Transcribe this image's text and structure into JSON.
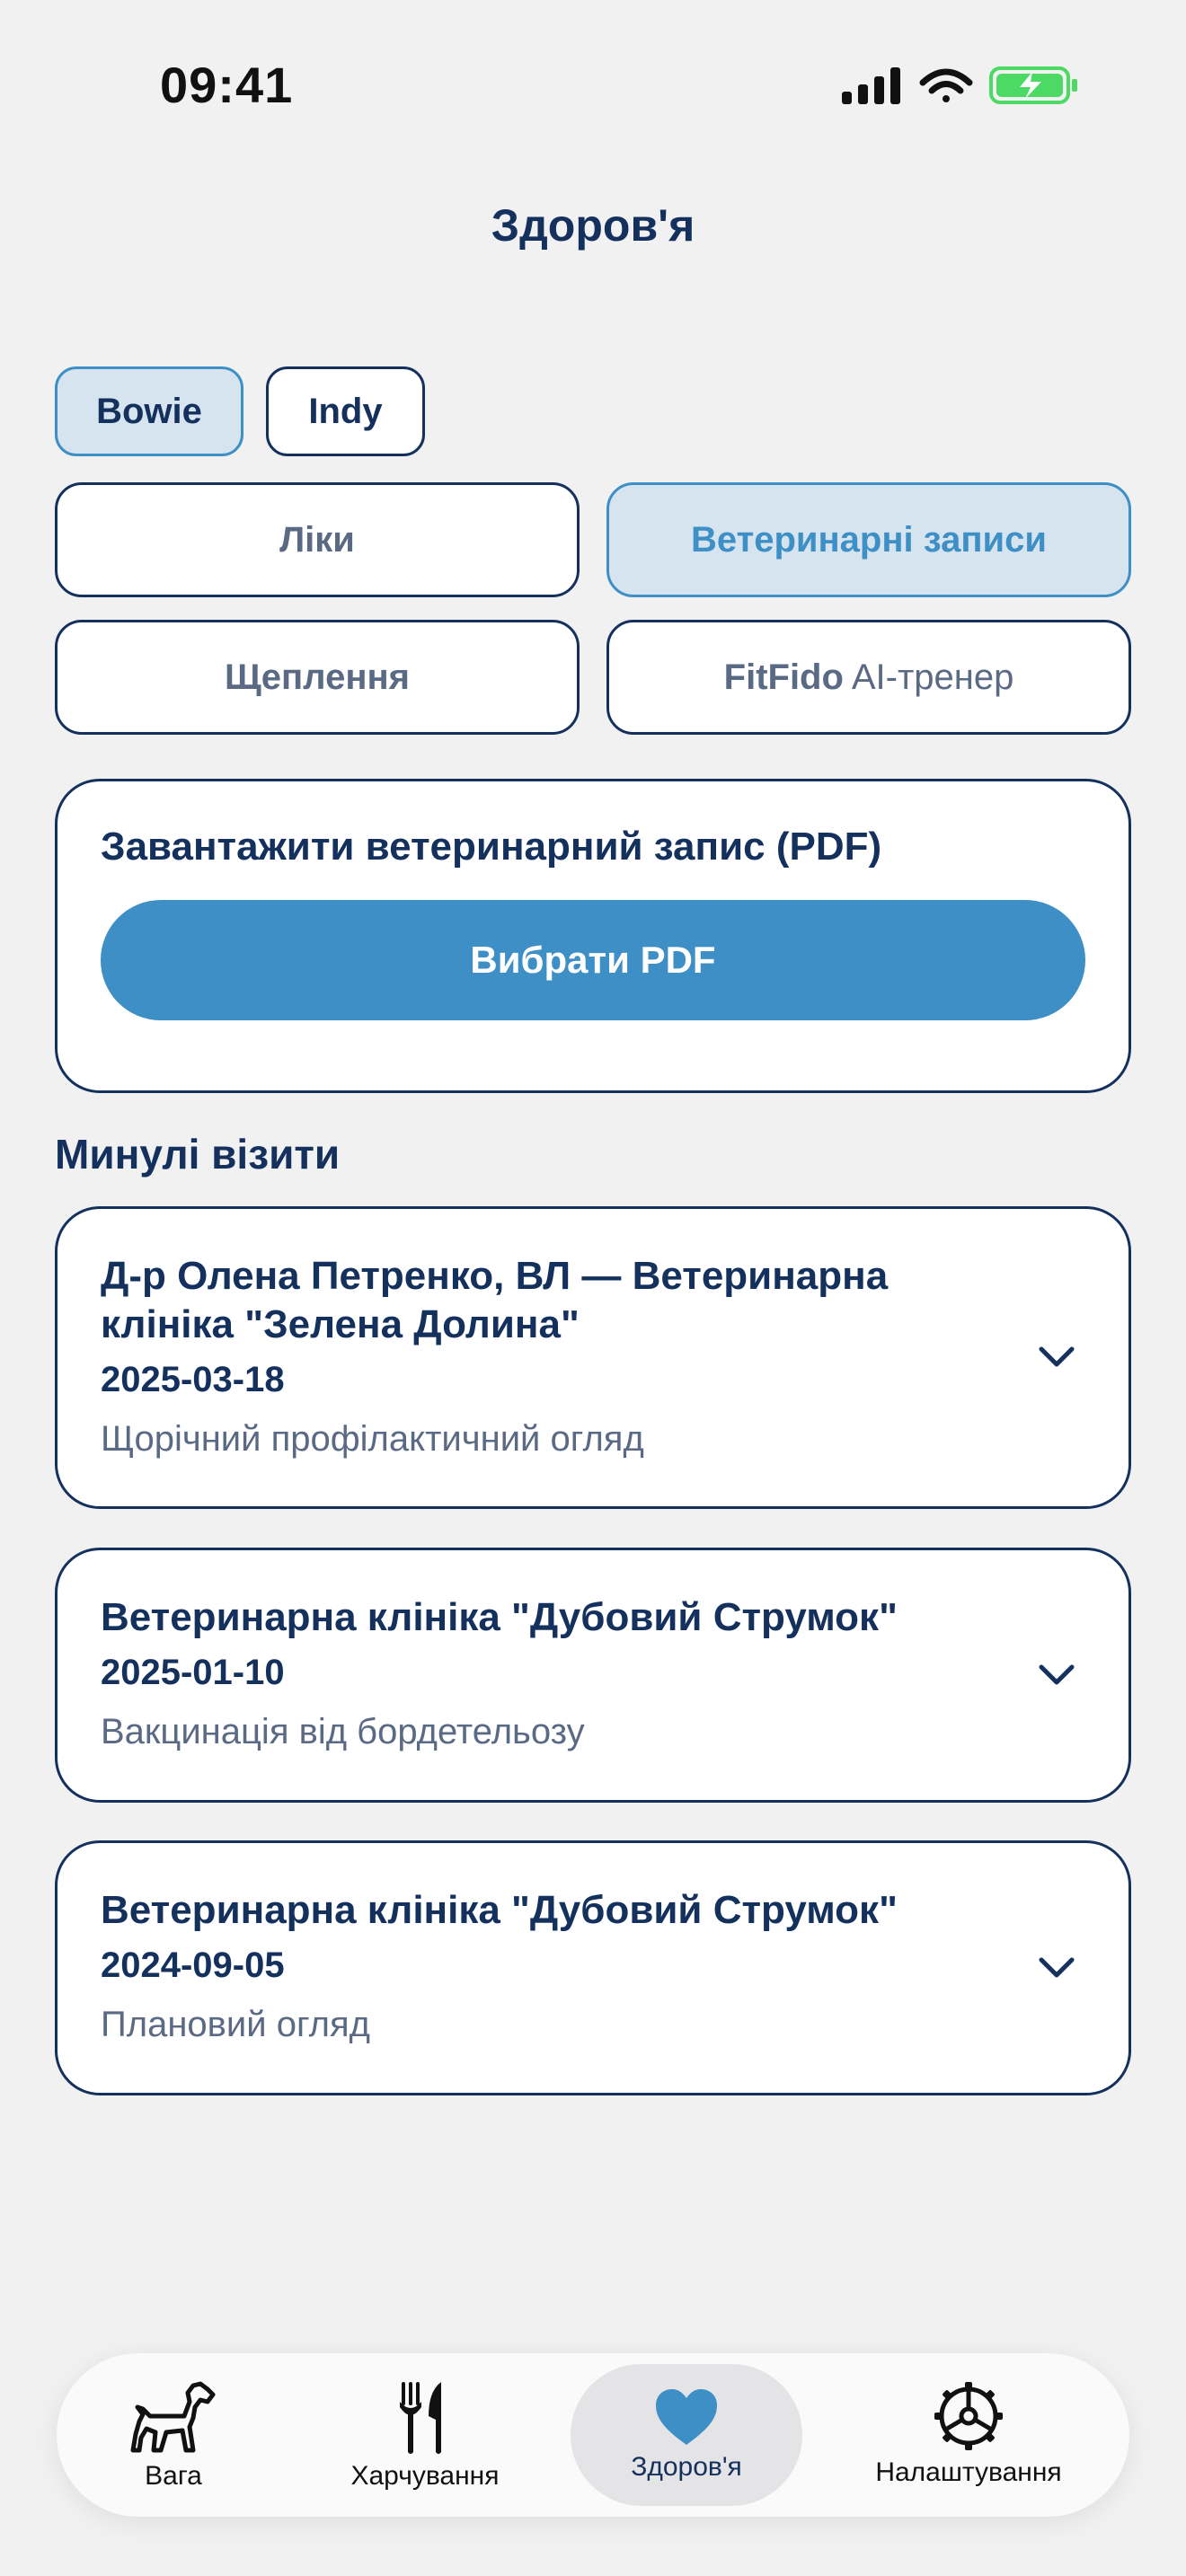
{
  "status_bar": {
    "time": "09:41"
  },
  "header": {
    "title": "Здоров'я"
  },
  "pets": [
    {
      "name": "Bowie",
      "selected": true
    },
    {
      "name": "Indy",
      "selected": false
    }
  ],
  "sections": [
    {
      "label": "Ліки",
      "selected": false
    },
    {
      "label": "Ветеринарні записи",
      "selected": true
    },
    {
      "label": "Щеплення",
      "selected": false
    },
    {
      "label_brand": "FitFido",
      "label_rest": " AI-тренер",
      "selected": false
    }
  ],
  "upload": {
    "title": "Завантажити ветеринарний запис (PDF)",
    "button_label": "Вибрати PDF"
  },
  "past_visits": {
    "heading": "Минулі візити",
    "items": [
      {
        "clinic_line1": "Д-р Олена Петренко, ВЛ — Ветеринарна",
        "clinic_line2": "клініка \"Зелена Долина\"",
        "date": "2025-03-18",
        "description": "Щорічний профілактичний огляд"
      },
      {
        "clinic_line1": "Ветеринарна клініка \"Дубовий Струмок\"",
        "date": "2025-01-10",
        "description": "Вакцинація від бордетельозу"
      },
      {
        "clinic_line1": "Ветеринарна клініка \"Дубовий Струмок\"",
        "date": "2024-09-05",
        "description": "Плановий огляд"
      }
    ]
  },
  "tab_bar": {
    "items": [
      {
        "label": "Вага",
        "icon": "dog-icon"
      },
      {
        "label": "Харчування",
        "icon": "fork-knife-icon"
      },
      {
        "label": "Здоров'я",
        "icon": "heart-icon",
        "active": true
      },
      {
        "label": "Налаштування",
        "icon": "gear-icon"
      }
    ]
  },
  "colors": {
    "accent": "#3d8fc6",
    "navy": "#14315e",
    "muted": "#5a6a84",
    "selected_bg": "#d6e4ef",
    "background": "#f1f1f2",
    "battery_green": "#4cd964"
  }
}
